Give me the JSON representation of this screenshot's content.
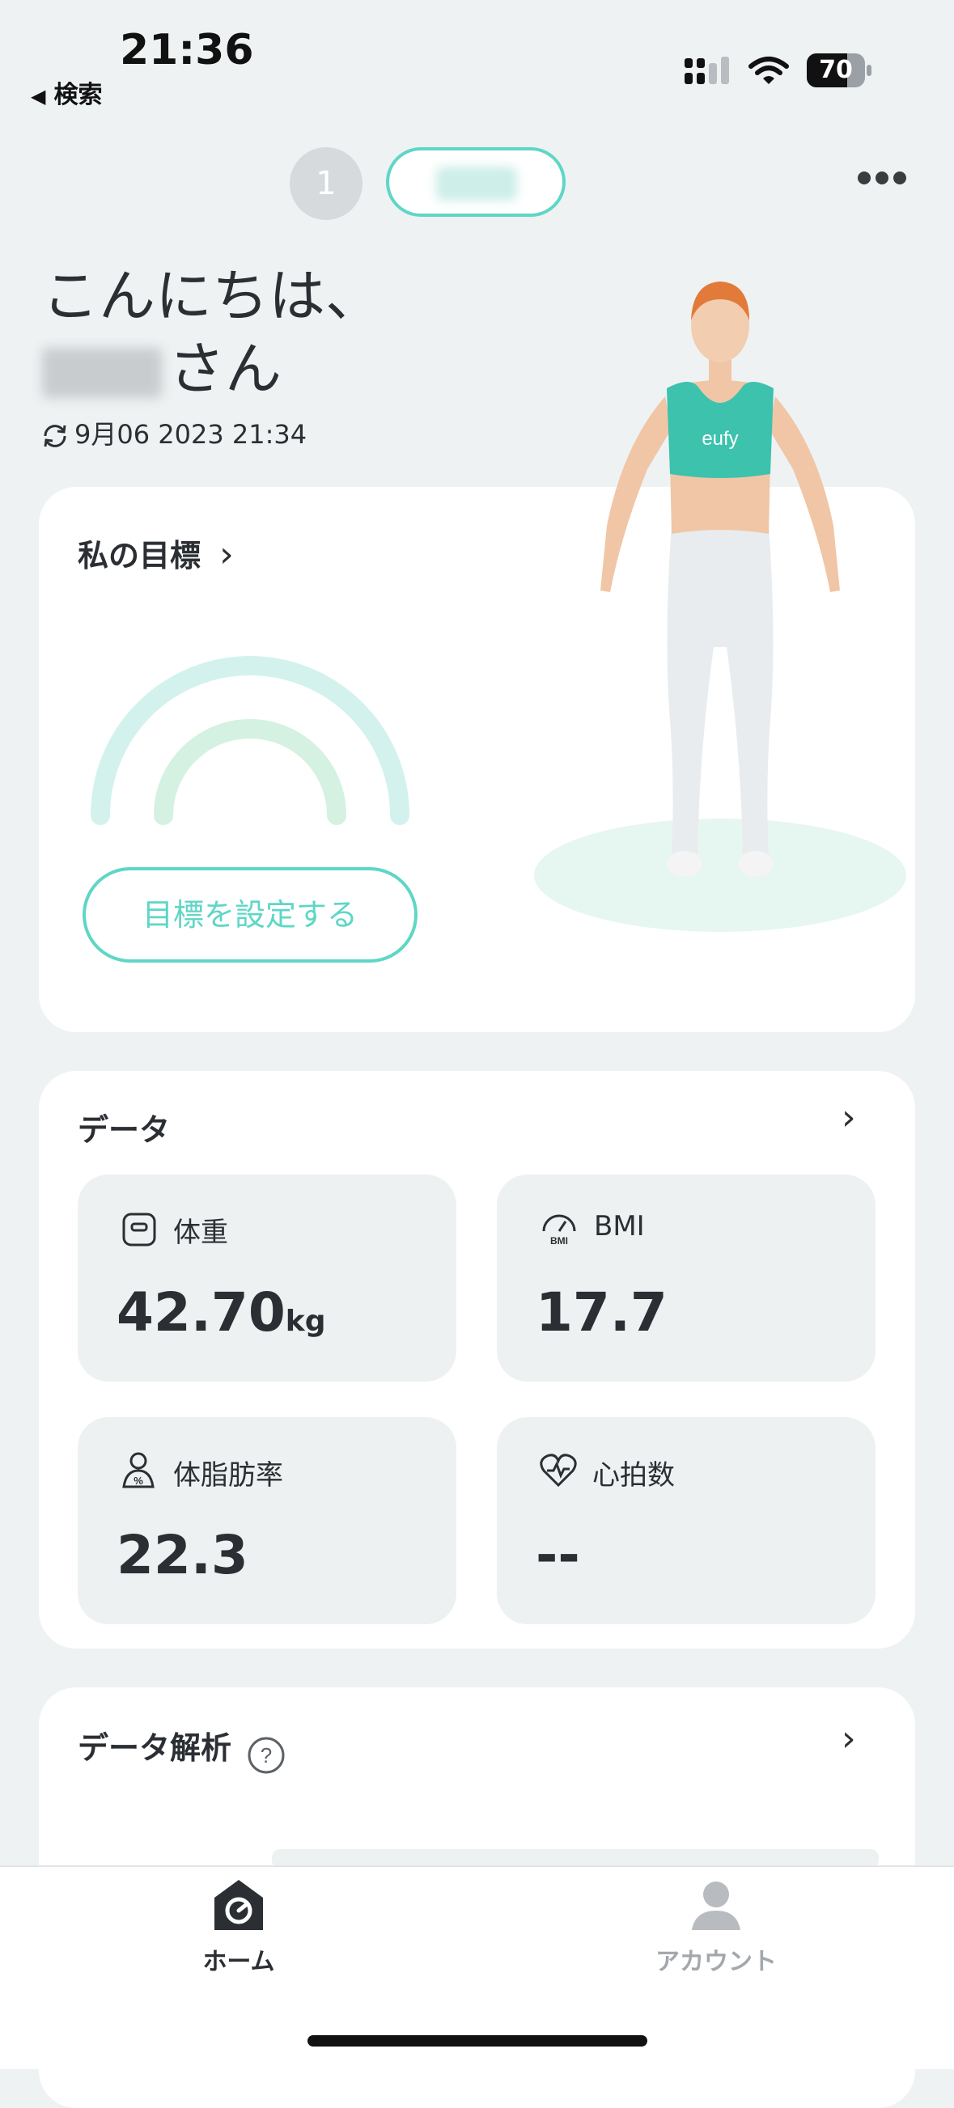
{
  "status_bar": {
    "time": "21:36",
    "back_label": "検索",
    "battery": "70"
  },
  "user_switcher": {
    "index": "1"
  },
  "greeting": {
    "line1": "こんにちは、",
    "suffix": "さん"
  },
  "sync": {
    "timestamp": "9月06 2023 21:34"
  },
  "goal": {
    "title": "私の目標",
    "set_goal_button": "目標を設定する"
  },
  "avatar": {
    "shirt_logo": "eufy"
  },
  "data_section": {
    "title": "データ",
    "tiles": [
      {
        "label": "体重",
        "value": "42.70",
        "unit": "kg",
        "icon": "scale-icon"
      },
      {
        "label": "BMI",
        "value": "17.7",
        "unit": "",
        "icon": "bmi-gauge-icon"
      },
      {
        "label": "体脂肪率",
        "value": "22.3",
        "unit": "",
        "icon": "body-fat-icon"
      },
      {
        "label": "心拍数",
        "value": "--",
        "unit": "",
        "icon": "heart-rate-icon"
      }
    ]
  },
  "analysis": {
    "title": "データ解析"
  },
  "tabs": [
    {
      "label": "ホーム",
      "active": true
    },
    {
      "label": "アカウント",
      "active": false
    }
  ],
  "colors": {
    "accent": "#5fd6c6",
    "background": "#eef2f3",
    "tile": "#eef1f2",
    "inactive_tab": "#a3a8ad"
  }
}
